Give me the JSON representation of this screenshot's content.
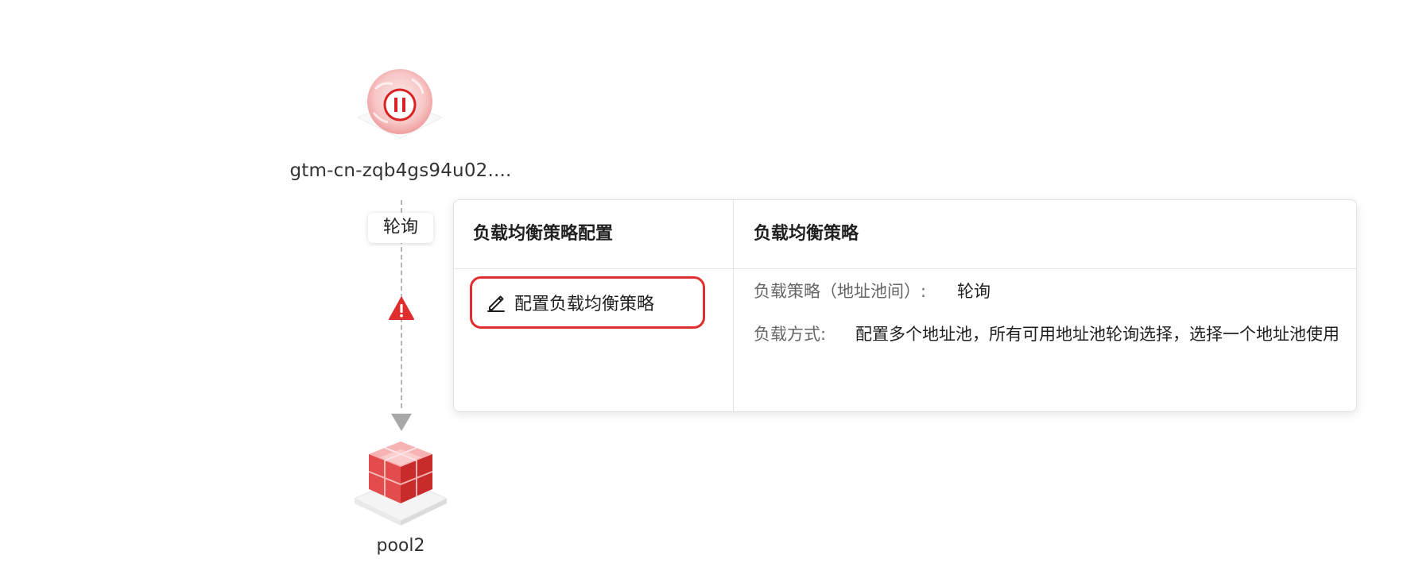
{
  "topology": {
    "gtm_node": {
      "label": "gtm-cn-zqb4gs94u02....",
      "icon": "pause-icon",
      "status_color": "#e02d2d"
    },
    "strategy_tag": "轮询",
    "warning_icon": "warning-icon",
    "pool_node": {
      "label": "pool2",
      "icon": "address-pool-icon"
    }
  },
  "popover": {
    "left_header": "负载均衡策略配置",
    "right_header": "负载均衡策略",
    "config_button": {
      "label": "配置负载均衡策略",
      "icon": "edit-icon",
      "highlight_color": "#e02d2d"
    },
    "details": [
      {
        "key": "负载策略（地址池间）:",
        "value": "轮询"
      },
      {
        "key": "负载方式:",
        "value": "配置多个地址池，所有可用地址池轮询选择，选择一个地址池使用"
      }
    ]
  }
}
